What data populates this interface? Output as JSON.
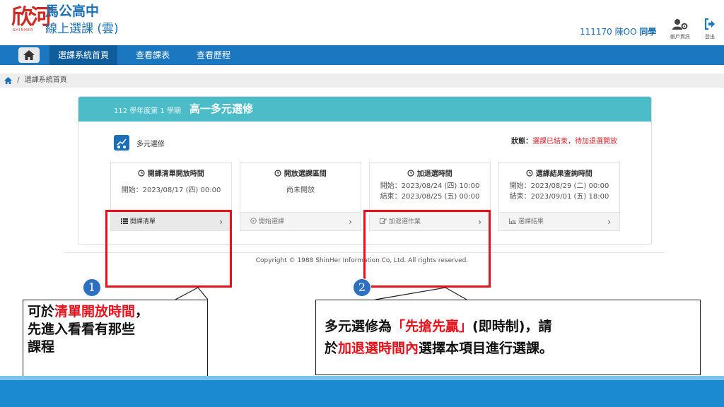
{
  "header": {
    "logo_mark": "欣河",
    "logo_sub": "SHINHER",
    "school": "馬公高中",
    "system": "線上選課 (雲)",
    "user_id": "111170 陳OO",
    "user_role": "同學",
    "account_label": "帳戶資訊",
    "logout_label": "登出"
  },
  "nav": {
    "home_icon": "home-icon",
    "items": [
      {
        "label": "選課系統首頁"
      },
      {
        "label": "查看課表"
      },
      {
        "label": "查看歷程"
      }
    ]
  },
  "breadcrumb": {
    "separator": "/",
    "current": "選課系統首頁"
  },
  "panel": {
    "term": "112 學年度第 1 學期",
    "title": "高一多元選修",
    "category": "多元選修",
    "status_label": "狀態：",
    "status_value": "選課已結束，待加退選開放",
    "cards": [
      {
        "title": "開課清單開放時間",
        "lines": [
          "開始：2023/08/17 (四) 00:00"
        ],
        "action": "開課清單",
        "action_icon": "list-icon"
      },
      {
        "title": "開放選課區間",
        "lines": [
          "尚未開放"
        ],
        "action": "開始選課",
        "action_icon": "play-icon"
      },
      {
        "title": "加退選時間",
        "lines": [
          "開始：2023/08/24 (四) 10:00",
          "結束：2023/08/25 (五) 00:00"
        ],
        "action": "加退選作業",
        "action_icon": "edit-icon"
      },
      {
        "title": "選課結果查詢時間",
        "lines": [
          "開始：2023/08/29 (二) 00:00",
          "結束：2023/09/01 (五) 18:00"
        ],
        "action": "選課結果",
        "action_icon": "chart-icon"
      }
    ]
  },
  "footer": {
    "copyright": "Copyright © 1988 ShinHer Information Co, Ltd. All rights reserved."
  },
  "annotations": {
    "badge1": "1",
    "badge2": "2",
    "callout1": {
      "p1": "可於",
      "hl1": "清單開放時間",
      "p2": "，",
      "line2": "先進入看看有那些",
      "line3": "課程"
    },
    "callout2": {
      "p1": "多元選修為",
      "hl1": "「先搶先贏」",
      "p2": "(即時制)，請",
      "p3": "於",
      "hl2": "加退選時間內",
      "p4": "選擇本項目進行選課。"
    }
  },
  "colors": {
    "nav": "#1b77c0",
    "panel_header": "#4bbcc8",
    "highlight": "#e8111b",
    "badge": "#2d6fc0"
  }
}
